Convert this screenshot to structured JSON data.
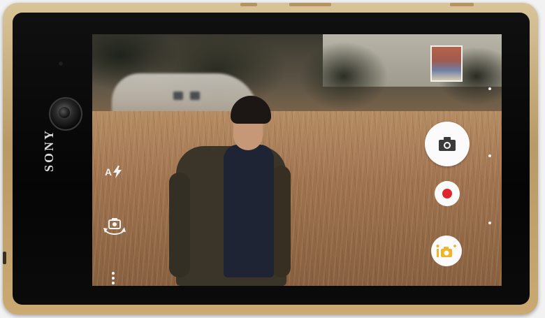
{
  "device": {
    "brand": "SONY",
    "frame_color": "#caa972"
  },
  "camera_ui": {
    "flash_label": "A",
    "icons": {
      "flash": "flash-auto-icon",
      "switch_camera": "switch-camera-icon",
      "more": "more-options-icon",
      "shutter": "camera-shutter-icon",
      "record": "record-video-icon",
      "apps": "camera-apps-icon",
      "thumbnail": "last-photo-thumbnail"
    },
    "colors": {
      "record": "#e0262a",
      "apps_accent": "#f0b428",
      "button_bg": "#fbfbfb"
    }
  }
}
